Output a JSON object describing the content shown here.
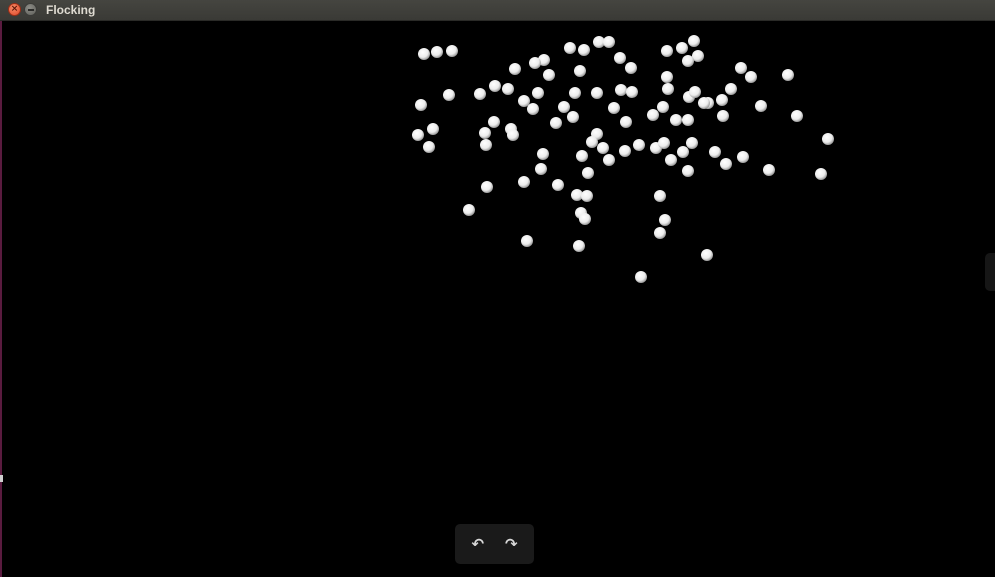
{
  "window": {
    "title": "Flocking",
    "close_symbol": "×"
  },
  "scene": {
    "boid_color": "#ececec",
    "boid_highlight": "#ffffff",
    "boid_shade": "#9a9a9a",
    "background_color": "#000000"
  },
  "toolbar": {
    "undo_icon": "↶",
    "redo_icon": "↷",
    "undo_name": "rotate-left-icon",
    "redo_name": "rotate-right-icon"
  }
}
